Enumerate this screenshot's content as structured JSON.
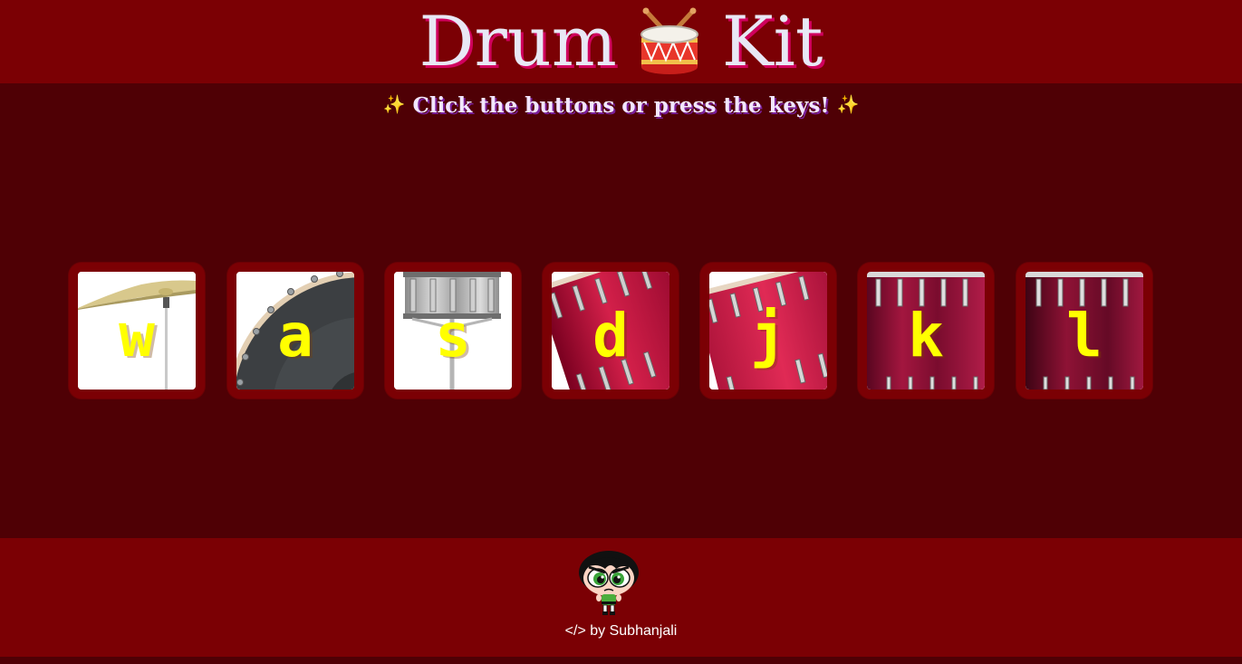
{
  "header": {
    "title_left": "Drum",
    "title_right": "Kit",
    "title_icon": "drum-icon"
  },
  "subtitle": {
    "sparkle_icon": "sparkles-icon",
    "text": "Click the buttons or press the keys!"
  },
  "pads": [
    {
      "key": "w",
      "instrument_icon": "crash-cymbal-icon"
    },
    {
      "key": "a",
      "instrument_icon": "kick-drum-icon"
    },
    {
      "key": "s",
      "instrument_icon": "snare-drum-icon"
    },
    {
      "key": "d",
      "instrument_icon": "tom-1-icon"
    },
    {
      "key": "j",
      "instrument_icon": "tom-2-icon"
    },
    {
      "key": "k",
      "instrument_icon": "tom-3-icon"
    },
    {
      "key": "l",
      "instrument_icon": "tom-4-icon"
    }
  ],
  "footer": {
    "avatar_icon": "buttercup-avatar-icon",
    "credit": "</> by Subhanjali"
  },
  "colors": {
    "page_background": "#4f0005",
    "header_background": "#7b0004",
    "pad_border": "#7b0004",
    "key_letter": "#ffff00",
    "title_text": "#e8e8f5",
    "title_shadow": "#d0005e"
  }
}
